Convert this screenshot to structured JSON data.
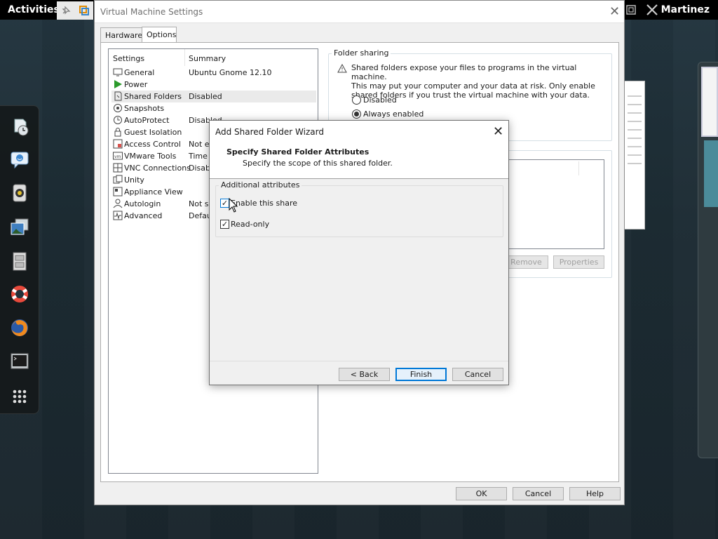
{
  "topbar": {
    "activities": "Activities",
    "user": "Martinez"
  },
  "main_window": {
    "title": "Virtual Machine Settings",
    "tabs": [
      {
        "label": "Hardware"
      },
      {
        "label": "Options"
      }
    ],
    "list_headers": {
      "settings": "Settings",
      "summary": "Summary"
    },
    "items": [
      {
        "name": "General",
        "summary": "Ubuntu Gnome 12.10",
        "icon": "monitor-icon"
      },
      {
        "name": "Power",
        "summary": "",
        "icon": "play-icon"
      },
      {
        "name": "Shared Folders",
        "summary": "Disabled",
        "icon": "shared-folder-icon"
      },
      {
        "name": "Snapshots",
        "summary": "",
        "icon": "snapshot-icon"
      },
      {
        "name": "AutoProtect",
        "summary": "Disabled",
        "icon": "clock-icon"
      },
      {
        "name": "Guest Isolation",
        "summary": "",
        "icon": "lock-icon"
      },
      {
        "name": "Access Control",
        "summary": "Not en",
        "icon": "access-control-icon"
      },
      {
        "name": "VMware Tools",
        "summary": "Time s",
        "icon": "vmware-tools-icon"
      },
      {
        "name": "VNC Connections",
        "summary": "Disable",
        "icon": "vnc-icon"
      },
      {
        "name": "Unity",
        "summary": "",
        "icon": "unity-icon"
      },
      {
        "name": "Appliance View",
        "summary": "",
        "icon": "appliance-icon"
      },
      {
        "name": "Autologin",
        "summary": "Not su",
        "icon": "user-icon"
      },
      {
        "name": "Advanced",
        "summary": "Defau",
        "icon": "advanced-icon"
      }
    ],
    "folder_sharing": {
      "label": "Folder sharing",
      "warning_line1": "Shared folders expose your files to programs in the virtual machine.",
      "warning_line2": "This may put your computer and your data at risk. Only enable",
      "warning_line3": "shared folders if you trust the virtual machine with your data.",
      "options": [
        "Disabled",
        "Always enabled"
      ],
      "selected": "Always enabled"
    },
    "folders_buttons": {
      "remove": "Remove",
      "properties": "Properties"
    },
    "footer_buttons": {
      "ok": "OK",
      "cancel": "Cancel",
      "help": "Help"
    }
  },
  "wizard": {
    "title": "Add Shared Folder Wizard",
    "heading": "Specify Shared Folder Attributes",
    "subheading": "Specify the scope of this shared folder.",
    "group_label": "Additional attributes",
    "enable_share": {
      "label": "Enable this share",
      "checked": true
    },
    "read_only": {
      "label": "Read-only",
      "checked": true
    },
    "buttons": {
      "back": "< Back",
      "finish": "Finish",
      "cancel": "Cancel"
    }
  },
  "dash_apps": [
    "system-clock-icon",
    "empathy-chat-icon",
    "rhythmbox-icon",
    "image-viewer-icon",
    "file-cabinet-icon",
    "help-lifebuoy-icon",
    "firefox-icon",
    "terminal-icon",
    "app-grid-icon"
  ]
}
